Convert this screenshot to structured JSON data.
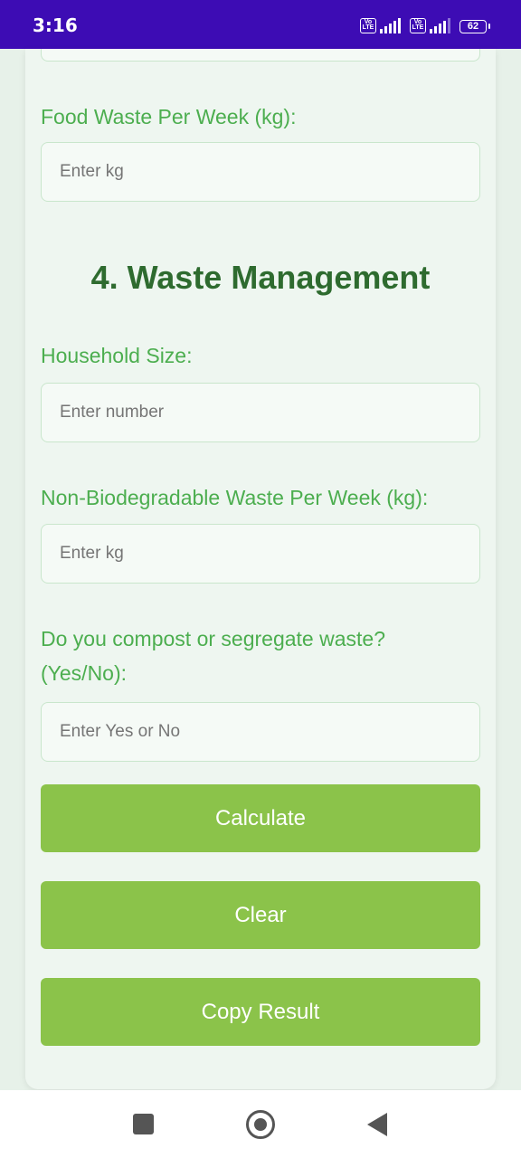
{
  "status_bar": {
    "time": "3:16",
    "battery": "62",
    "sim_badge": "Vo LTE"
  },
  "form": {
    "food_waste": {
      "label": "Food Waste Per Week (kg):",
      "placeholder": "Enter kg",
      "value": ""
    },
    "section_title": "4. Waste Management",
    "household_size": {
      "label": "Household Size:",
      "placeholder": "Enter number",
      "value": ""
    },
    "non_bio_waste": {
      "label": "Non-Biodegradable Waste Per Week (kg):",
      "placeholder": "Enter kg",
      "value": ""
    },
    "compost": {
      "label": "Do you compost or segregate waste? (Yes/No):",
      "placeholder": "Enter Yes or No",
      "value": ""
    }
  },
  "buttons": {
    "calculate": "Calculate",
    "clear": "Clear",
    "copy_result": "Copy Result"
  },
  "colors": {
    "status_bar": "#3d0cb4",
    "label_green": "#4cae4f",
    "title_green": "#2e6b2f",
    "button_green": "#8bc34a"
  },
  "icons": {
    "nav_recents": "square-icon",
    "nav_home": "home-circle-icon",
    "nav_back": "back-triangle-icon"
  }
}
